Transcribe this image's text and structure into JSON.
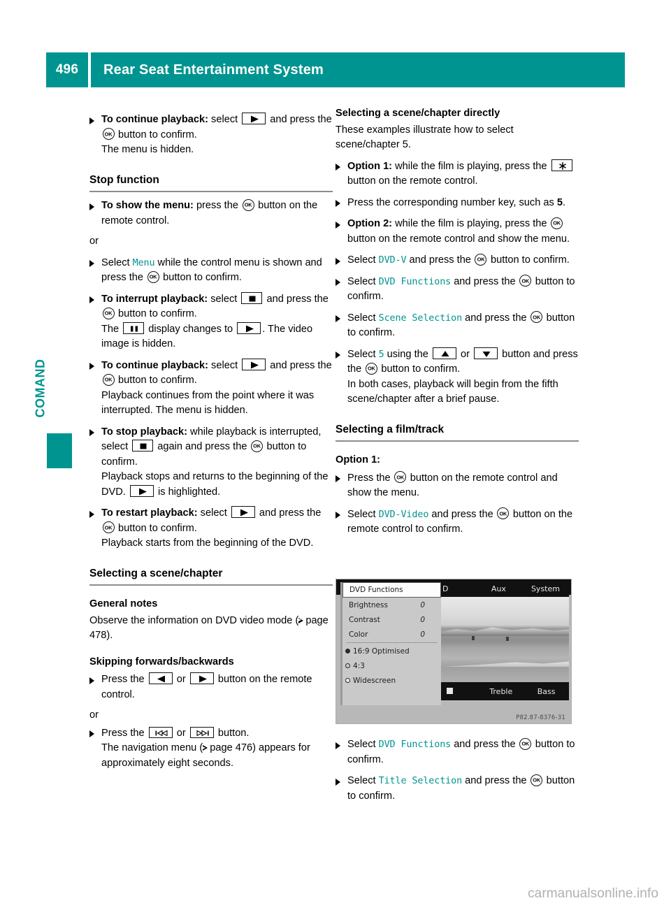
{
  "header": {
    "page_number": "496",
    "title": "Rear Seat Entertainment System",
    "accent_color": "#009490"
  },
  "side_tab": {
    "label": "COMAND"
  },
  "left_column": {
    "step_continue_1": {
      "lead": "To continue playback:",
      "text_1": " select ",
      "icon_1": "play-button-key",
      "text_2": " and press the ",
      "icon_2": "ok-button",
      "text_3": " button to confirm.",
      "line_2": "The menu is hidden."
    },
    "heading_stop_function": "Stop function",
    "step_show_menu": {
      "lead": "To show the menu:",
      "text_1": " press the ",
      "icon_1": "ok-button",
      "text_2": " button on the remote control."
    },
    "or_1": "or",
    "step_select_menu": {
      "text_1": "Select ",
      "ui_1": "Menu",
      "text_2": " while the control menu is shown and press the ",
      "icon_1": "ok-button",
      "text_3": " button to confirm."
    },
    "step_interrupt": {
      "lead": "To interrupt playback:",
      "text_1": " select ",
      "icon_1": "stop-button-key",
      "text_2": " and press the ",
      "icon_2": "ok-button",
      "text_3": " button to confirm.",
      "line_2_a": "The ",
      "line_2_icon": "pause-button-key",
      "line_2_b": " display changes to ",
      "line_2_icon_2": "play-button-key",
      "line_2_c": ". The video image is hidden."
    },
    "step_continue_2": {
      "lead": "To continue playback:",
      "text_1": " select ",
      "icon_1": "play-button-key",
      "text_2": " and press the ",
      "icon_2": "ok-button",
      "text_3": " button to confirm.",
      "line_2": "Playback continues from the point where it was interrupted. The menu is hidden."
    },
    "step_stop": {
      "lead": "To stop playback:",
      "text_1": " while playback is interrupted, select ",
      "icon_1": "stop-button-key",
      "text_2": " again and press the ",
      "icon_2": "ok-button",
      "text_3": " button to confirm.",
      "line_2_a": "Playback stops and returns to the beginning of the DVD. ",
      "line_2_icon": "play-button-key",
      "line_2_b": " is highlighted."
    },
    "step_restart": {
      "lead": "To restart playback:",
      "text_1": " select ",
      "icon_1": "play-button-key",
      "text_2": " and press the ",
      "icon_2": "ok-button",
      "text_3": " button to confirm.",
      "line_2": "Playback starts from the beginning of the DVD."
    },
    "heading_selecting_scene": "Selecting a scene/chapter",
    "heading_general_notes": "General notes",
    "general_notes_text_a": "Observe the information on DVD video mode (",
    "general_notes_page": "page 478",
    "general_notes_text_b": ").",
    "heading_skipping": "Skipping forwards/backwards",
    "step_press_arrows": {
      "text_1": "Press the ",
      "icon_1": "rewind-arrow-key",
      "text_2": " or ",
      "icon_2": "forward-arrow-key",
      "text_3": " button on the remote control."
    },
    "or_2": "or",
    "step_press_skip": {
      "text_1": "Press the ",
      "icon_1": "skip-back-key",
      "text_2": " or ",
      "icon_2": "skip-forward-key",
      "text_3": " button.",
      "line_2_a": "The navigation menu (",
      "line_2_page": "page 476",
      "line_2_b": ") appears for approximately eight seconds."
    }
  },
  "right_column": {
    "heading_selecting_directly": "Selecting a scene/chapter directly",
    "intro_text": "These examples illustrate how to select scene/chapter 5.",
    "step_option1": {
      "lead": "Option 1:",
      "text_1": " while the film is playing, press the ",
      "icon_1": "asterisk-button-key",
      "text_2": " button on the remote control."
    },
    "step_number_key": {
      "text_1": "Press the corresponding number key, such as ",
      "bold_1": "5",
      "text_2": "."
    },
    "step_option2": {
      "lead": "Option 2:",
      "text_1": " while the film is playing, press the ",
      "icon_1": "ok-button",
      "text_2": " button on the remote control and show the menu."
    },
    "step_select_dvdv": {
      "text_1": "Select ",
      "ui_1": "DVD-V",
      "text_2": " and press the ",
      "icon_1": "ok-button",
      "text_3": " button to confirm."
    },
    "step_select_dvdfunc": {
      "text_1": "Select ",
      "ui_1": "DVD Functions",
      "text_2": " and press the ",
      "icon_1": "ok-button",
      "text_3": " button to confirm."
    },
    "step_select_scenesel": {
      "text_1": "Select ",
      "ui_1": "Scene Selection",
      "text_2": " and press the ",
      "icon_1": "ok-button",
      "text_3": " button to confirm."
    },
    "step_select_5": {
      "text_1": "Select ",
      "ui_1": "5",
      "text_2": " using the ",
      "icon_1": "up-arrow-key",
      "text_3": " or ",
      "icon_2": "down-arrow-key",
      "text_4": " button and press the ",
      "icon_3": "ok-button",
      "text_5": " button to confirm.",
      "line_2": "In both cases, playback will begin from the fifth scene/chapter after a brief pause."
    },
    "heading_selecting_film": "Selecting a film/track",
    "heading_option1": "Option 1:",
    "step_press_ok": {
      "text_1": "Press the ",
      "icon_1": "ok-button",
      "text_2": " button on the remote control and show the menu."
    },
    "step_select_dvdvideo": {
      "text_1": "Select ",
      "ui_1": "DVD-Video",
      "text_2": " and press the ",
      "icon_1": "ok-button",
      "text_3": " button on the remote control to confirm."
    },
    "step_select_dvdfunc2": {
      "text_1": "Select ",
      "ui_1": "DVD Functions",
      "text_2": " and press the ",
      "icon_1": "ok-button",
      "text_3": " button to confirm."
    },
    "step_select_titlesel": {
      "text_1": "Select ",
      "ui_1": "Title Selection",
      "text_2": " and press the ",
      "icon_1": "ok-button",
      "text_3": " button to confirm."
    }
  },
  "figure": {
    "menu_header": "DVD Functions",
    "rows": [
      {
        "label": "Brightness",
        "value": "0"
      },
      {
        "label": "Contrast",
        "value": "0"
      },
      {
        "label": "Color",
        "value": "0"
      }
    ],
    "radio_options": [
      {
        "label": "16:9 Optimised",
        "state": "on"
      },
      {
        "label": "4:3",
        "state": "off"
      },
      {
        "label": "Widescreen",
        "state": "hollow"
      }
    ],
    "top_tabs": [
      "D",
      "Aux",
      "System"
    ],
    "bottom_tabs": [
      "Treble",
      "Bass"
    ],
    "caption_code": "P82.87-8376-31"
  },
  "watermark": "carmanualsonline.info"
}
